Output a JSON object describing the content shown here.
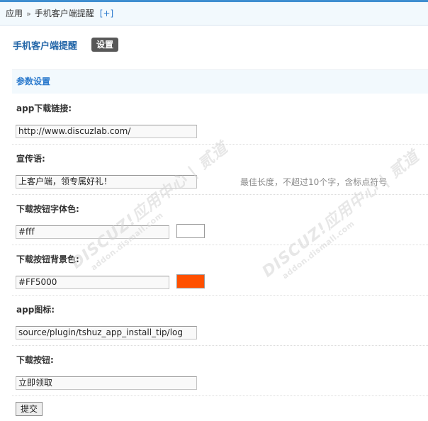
{
  "breadcrumb": {
    "root": "应用",
    "separator": "»",
    "current": "手机客户端提醒",
    "add": "[+]"
  },
  "plugin": {
    "title": "手机客户端提醒",
    "settings_tab": "设置"
  },
  "section": {
    "title": "参数设置"
  },
  "fields": [
    {
      "label": "app下载链接:",
      "value": "http://www.discuzlab.com/"
    },
    {
      "label": "宣传语:",
      "value": "上客户端，领专属好礼！",
      "tip": "最佳长度，不超过10个字，含标点符号"
    },
    {
      "label": "下载按钮字体色:",
      "value": "#fff",
      "swatch_color": "#ffffff"
    },
    {
      "label": "下载按钮背景色:",
      "value": "#FF5000",
      "swatch_color": "#ff5000"
    },
    {
      "label": "app图标:",
      "value": "source/plugin/tshuz_app_install_tip/log"
    },
    {
      "label": "下载按钮:",
      "value": "立即领取"
    }
  ],
  "submit_label": "提交",
  "watermark": {
    "title": "DISCUZ!应用中心 | 贰道",
    "sub": "addon.dismall.com"
  },
  "colors": {
    "accent": "#2b7acd",
    "header_bg": "#f2f9fd",
    "tab_bg": "#585858"
  }
}
